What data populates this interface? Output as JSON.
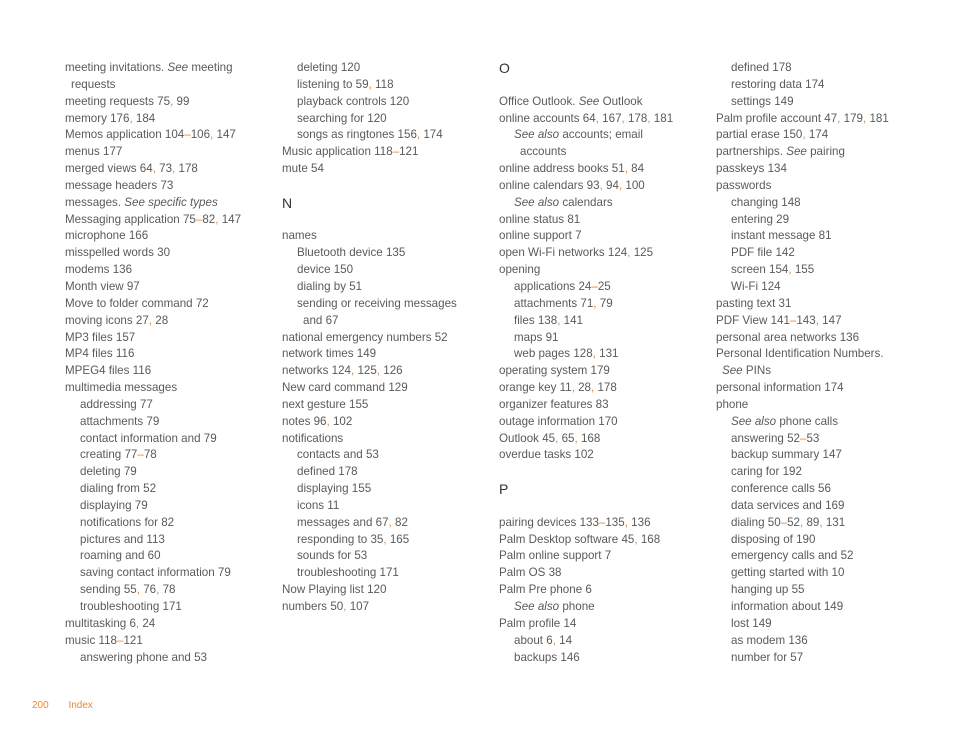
{
  "footer": {
    "page_number": "200",
    "section": "Index"
  },
  "columns": [
    [
      {
        "t": "entry",
        "lvl": 0,
        "text": "meeting invitations. ",
        "see": "See",
        "rest": " meeting"
      },
      {
        "t": "entry",
        "lvl": 0,
        "cont": true,
        "text": "requests"
      },
      {
        "t": "entry",
        "lvl": 0,
        "text": "meeting requests ",
        "pages": [
          "75",
          "99"
        ]
      },
      {
        "t": "entry",
        "lvl": 0,
        "text": "memory ",
        "pages": [
          "176",
          "184"
        ]
      },
      {
        "t": "entry",
        "lvl": 0,
        "text": "Memos application ",
        "pages": [
          "104–106",
          "147"
        ]
      },
      {
        "t": "entry",
        "lvl": 0,
        "text": "menus ",
        "pages": [
          "177"
        ]
      },
      {
        "t": "entry",
        "lvl": 0,
        "text": "merged views ",
        "pages": [
          "64",
          "73",
          "178"
        ]
      },
      {
        "t": "entry",
        "lvl": 0,
        "text": "message headers ",
        "pages": [
          "73"
        ]
      },
      {
        "t": "entry",
        "lvl": 0,
        "text": "messages. ",
        "italic": "See specific types"
      },
      {
        "t": "entry",
        "lvl": 0,
        "text": "Messaging application ",
        "pages": [
          "75–82",
          "147"
        ]
      },
      {
        "t": "entry",
        "lvl": 0,
        "text": "microphone ",
        "pages": [
          "166"
        ]
      },
      {
        "t": "entry",
        "lvl": 0,
        "text": "misspelled words ",
        "pages": [
          "30"
        ]
      },
      {
        "t": "entry",
        "lvl": 0,
        "text": "modems ",
        "pages": [
          "136"
        ]
      },
      {
        "t": "entry",
        "lvl": 0,
        "text": "Month view ",
        "pages": [
          "97"
        ]
      },
      {
        "t": "entry",
        "lvl": 0,
        "text": "Move to folder command ",
        "pages": [
          "72"
        ]
      },
      {
        "t": "entry",
        "lvl": 0,
        "text": "moving icons ",
        "pages": [
          "27",
          "28"
        ]
      },
      {
        "t": "entry",
        "lvl": 0,
        "text": "MP3 files ",
        "pages": [
          "157"
        ]
      },
      {
        "t": "entry",
        "lvl": 0,
        "text": "MP4 files ",
        "pages": [
          "116"
        ]
      },
      {
        "t": "entry",
        "lvl": 0,
        "text": "MPEG4 files ",
        "pages": [
          "116"
        ]
      },
      {
        "t": "entry",
        "lvl": 0,
        "text": "multimedia messages"
      },
      {
        "t": "entry",
        "lvl": 1,
        "text": "addressing ",
        "pages": [
          "77"
        ]
      },
      {
        "t": "entry",
        "lvl": 1,
        "text": "attachments ",
        "pages": [
          "79"
        ]
      },
      {
        "t": "entry",
        "lvl": 1,
        "text": "contact information and ",
        "pages": [
          "79"
        ]
      },
      {
        "t": "entry",
        "lvl": 1,
        "text": "creating ",
        "pages": [
          "77–78"
        ]
      },
      {
        "t": "entry",
        "lvl": 1,
        "text": "deleting ",
        "pages": [
          "79"
        ]
      },
      {
        "t": "entry",
        "lvl": 1,
        "text": "dialing from ",
        "pages": [
          "52"
        ]
      },
      {
        "t": "entry",
        "lvl": 1,
        "text": "displaying ",
        "pages": [
          "79"
        ]
      },
      {
        "t": "entry",
        "lvl": 1,
        "text": "notifications for ",
        "pages": [
          "82"
        ]
      },
      {
        "t": "entry",
        "lvl": 1,
        "text": "pictures and ",
        "pages": [
          "113"
        ]
      },
      {
        "t": "entry",
        "lvl": 1,
        "text": "roaming and ",
        "pages": [
          "60"
        ]
      },
      {
        "t": "entry",
        "lvl": 1,
        "text": "saving contact information ",
        "pages": [
          "79"
        ]
      },
      {
        "t": "entry",
        "lvl": 1,
        "text": "sending ",
        "pages": [
          "55",
          "76",
          "78"
        ]
      },
      {
        "t": "entry",
        "lvl": 1,
        "text": "troubleshooting ",
        "pages": [
          "171"
        ]
      },
      {
        "t": "entry",
        "lvl": 0,
        "text": "multitasking ",
        "pages": [
          "6",
          "24"
        ]
      },
      {
        "t": "entry",
        "lvl": 0,
        "text": "music ",
        "pages": [
          "118–121"
        ]
      },
      {
        "t": "entry",
        "lvl": 1,
        "text": "answering phone and ",
        "pages": [
          "53"
        ]
      }
    ],
    [
      {
        "t": "entry",
        "lvl": 1,
        "text": "deleting ",
        "pages": [
          "120"
        ]
      },
      {
        "t": "entry",
        "lvl": 1,
        "text": "listening to ",
        "pages": [
          "59",
          "118"
        ]
      },
      {
        "t": "entry",
        "lvl": 1,
        "text": "playback controls ",
        "pages": [
          "120"
        ]
      },
      {
        "t": "entry",
        "lvl": 1,
        "text": "searching for ",
        "pages": [
          "120"
        ]
      },
      {
        "t": "entry",
        "lvl": 1,
        "text": "songs as ringtones ",
        "pages": [
          "156",
          "174"
        ]
      },
      {
        "t": "entry",
        "lvl": 0,
        "text": "Music application ",
        "pages": [
          "118–121"
        ]
      },
      {
        "t": "entry",
        "lvl": 0,
        "text": "mute ",
        "pages": [
          "54"
        ]
      },
      {
        "t": "gap"
      },
      {
        "t": "letter",
        "text": "N"
      },
      {
        "t": "entry",
        "lvl": 0,
        "text": "names"
      },
      {
        "t": "entry",
        "lvl": 1,
        "text": "Bluetooth device ",
        "pages": [
          "135"
        ]
      },
      {
        "t": "entry",
        "lvl": 1,
        "text": "device ",
        "pages": [
          "150"
        ]
      },
      {
        "t": "entry",
        "lvl": 1,
        "text": "dialing by ",
        "pages": [
          "51"
        ]
      },
      {
        "t": "entry",
        "lvl": 1,
        "text": "sending or receiving messages"
      },
      {
        "t": "entry",
        "lvl": 1,
        "cont": true,
        "text": "and ",
        "pages": [
          "67"
        ]
      },
      {
        "t": "entry",
        "lvl": 0,
        "text": "national emergency numbers ",
        "pages": [
          "52"
        ]
      },
      {
        "t": "entry",
        "lvl": 0,
        "text": "network times ",
        "pages": [
          "149"
        ]
      },
      {
        "t": "entry",
        "lvl": 0,
        "text": "networks ",
        "pages": [
          "124",
          "125",
          "126"
        ]
      },
      {
        "t": "entry",
        "lvl": 0,
        "text": "New card command ",
        "pages": [
          "129"
        ]
      },
      {
        "t": "entry",
        "lvl": 0,
        "text": "next gesture ",
        "pages": [
          "155"
        ]
      },
      {
        "t": "entry",
        "lvl": 0,
        "text": "notes ",
        "pages": [
          "96",
          "102"
        ]
      },
      {
        "t": "entry",
        "lvl": 0,
        "text": "notifications"
      },
      {
        "t": "entry",
        "lvl": 1,
        "text": "contacts and ",
        "pages": [
          "53"
        ]
      },
      {
        "t": "entry",
        "lvl": 1,
        "text": "defined ",
        "pages": [
          "178"
        ]
      },
      {
        "t": "entry",
        "lvl": 1,
        "text": "displaying ",
        "pages": [
          "155"
        ]
      },
      {
        "t": "entry",
        "lvl": 1,
        "text": "icons ",
        "pages": [
          "11"
        ]
      },
      {
        "t": "entry",
        "lvl": 1,
        "text": "messages and ",
        "pages": [
          "67",
          "82"
        ]
      },
      {
        "t": "entry",
        "lvl": 1,
        "text": "responding to ",
        "pages": [
          "35",
          "165"
        ]
      },
      {
        "t": "entry",
        "lvl": 1,
        "text": "sounds for ",
        "pages": [
          "53"
        ]
      },
      {
        "t": "entry",
        "lvl": 1,
        "text": "troubleshooting ",
        "pages": [
          "171"
        ]
      },
      {
        "t": "entry",
        "lvl": 0,
        "text": "Now Playing list ",
        "pages": [
          "120"
        ]
      },
      {
        "t": "entry",
        "lvl": 0,
        "text": "numbers ",
        "pages": [
          "50",
          "107"
        ]
      }
    ],
    [
      {
        "t": "letter",
        "text": "O"
      },
      {
        "t": "entry",
        "lvl": 0,
        "text": "Office Outlook. ",
        "see": "See",
        "rest": " Outlook"
      },
      {
        "t": "entry",
        "lvl": 0,
        "text": "online accounts ",
        "pages": [
          "64",
          "167",
          "178",
          "181"
        ]
      },
      {
        "t": "entry",
        "lvl": 1,
        "see": "See also",
        "rest": " accounts; email"
      },
      {
        "t": "entry",
        "lvl": 1,
        "cont": true,
        "text": "accounts"
      },
      {
        "t": "entry",
        "lvl": 0,
        "text": "online address books ",
        "pages": [
          "51",
          "84"
        ]
      },
      {
        "t": "entry",
        "lvl": 0,
        "text": "online calendars ",
        "pages": [
          "93",
          "94",
          "100"
        ]
      },
      {
        "t": "entry",
        "lvl": 1,
        "see": "See also",
        "rest": " calendars"
      },
      {
        "t": "entry",
        "lvl": 0,
        "text": "online status ",
        "pages": [
          "81"
        ]
      },
      {
        "t": "entry",
        "lvl": 0,
        "text": "online support ",
        "pages": [
          "7"
        ]
      },
      {
        "t": "entry",
        "lvl": 0,
        "text": "open Wi-Fi networks ",
        "pages": [
          "124",
          "125"
        ]
      },
      {
        "t": "entry",
        "lvl": 0,
        "text": "opening"
      },
      {
        "t": "entry",
        "lvl": 1,
        "text": "applications ",
        "pages": [
          "24–25"
        ]
      },
      {
        "t": "entry",
        "lvl": 1,
        "text": "attachments ",
        "pages": [
          "71",
          "79"
        ]
      },
      {
        "t": "entry",
        "lvl": 1,
        "text": "files ",
        "pages": [
          "138",
          "141"
        ]
      },
      {
        "t": "entry",
        "lvl": 1,
        "text": "maps ",
        "pages": [
          "91"
        ]
      },
      {
        "t": "entry",
        "lvl": 1,
        "text": "web pages ",
        "pages": [
          "128",
          "131"
        ]
      },
      {
        "t": "entry",
        "lvl": 0,
        "text": "operating system ",
        "pages": [
          "179"
        ]
      },
      {
        "t": "entry",
        "lvl": 0,
        "text": "orange key ",
        "pages": [
          "11",
          "28",
          "178"
        ]
      },
      {
        "t": "entry",
        "lvl": 0,
        "text": "organizer features ",
        "pages": [
          "83"
        ]
      },
      {
        "t": "entry",
        "lvl": 0,
        "text": "outage information ",
        "pages": [
          "170"
        ]
      },
      {
        "t": "entry",
        "lvl": 0,
        "text": "Outlook ",
        "pages": [
          "45",
          "65",
          "168"
        ]
      },
      {
        "t": "entry",
        "lvl": 0,
        "text": "overdue tasks ",
        "pages": [
          "102"
        ]
      },
      {
        "t": "gap"
      },
      {
        "t": "letter",
        "text": "P"
      },
      {
        "t": "entry",
        "lvl": 0,
        "text": "pairing devices ",
        "pages": [
          "133–135",
          "136"
        ]
      },
      {
        "t": "entry",
        "lvl": 0,
        "text": "Palm Desktop software ",
        "pages": [
          "45",
          "168"
        ]
      },
      {
        "t": "entry",
        "lvl": 0,
        "text": "Palm online support ",
        "pages": [
          "7"
        ]
      },
      {
        "t": "entry",
        "lvl": 0,
        "text": "Palm OS ",
        "pages": [
          "38"
        ]
      },
      {
        "t": "entry",
        "lvl": 0,
        "text": "Palm Pre phone ",
        "pages": [
          "6"
        ]
      },
      {
        "t": "entry",
        "lvl": 1,
        "see": "See also",
        "rest": " phone"
      },
      {
        "t": "entry",
        "lvl": 0,
        "text": "Palm profile ",
        "pages": [
          "14"
        ]
      },
      {
        "t": "entry",
        "lvl": 1,
        "text": "about ",
        "pages": [
          "6",
          "14"
        ]
      },
      {
        "t": "entry",
        "lvl": 1,
        "text": "backups ",
        "pages": [
          "146"
        ]
      }
    ],
    [
      {
        "t": "entry",
        "lvl": 1,
        "text": "defined ",
        "pages": [
          "178"
        ]
      },
      {
        "t": "entry",
        "lvl": 1,
        "text": "restoring data ",
        "pages": [
          "174"
        ]
      },
      {
        "t": "entry",
        "lvl": 1,
        "text": "settings ",
        "pages": [
          "149"
        ]
      },
      {
        "t": "entry",
        "lvl": 0,
        "text": "Palm profile account ",
        "pages": [
          "47",
          "179",
          "181"
        ]
      },
      {
        "t": "entry",
        "lvl": 0,
        "text": "partial erase ",
        "pages": [
          "150",
          "174"
        ]
      },
      {
        "t": "entry",
        "lvl": 0,
        "text": "partnerships. ",
        "see": "See",
        "rest": " pairing"
      },
      {
        "t": "entry",
        "lvl": 0,
        "text": "passkeys ",
        "pages": [
          "134"
        ]
      },
      {
        "t": "entry",
        "lvl": 0,
        "text": "passwords"
      },
      {
        "t": "entry",
        "lvl": 1,
        "text": "changing ",
        "pages": [
          "148"
        ]
      },
      {
        "t": "entry",
        "lvl": 1,
        "text": "entering ",
        "pages": [
          "29"
        ]
      },
      {
        "t": "entry",
        "lvl": 1,
        "text": "instant message ",
        "pages": [
          "81"
        ]
      },
      {
        "t": "entry",
        "lvl": 1,
        "text": "PDF file ",
        "pages": [
          "142"
        ]
      },
      {
        "t": "entry",
        "lvl": 1,
        "text": "screen ",
        "pages": [
          "154",
          "155"
        ]
      },
      {
        "t": "entry",
        "lvl": 1,
        "text": "Wi-Fi ",
        "pages": [
          "124"
        ]
      },
      {
        "t": "entry",
        "lvl": 0,
        "text": "pasting text ",
        "pages": [
          "31"
        ]
      },
      {
        "t": "entry",
        "lvl": 0,
        "text": "PDF View ",
        "pages": [
          "141–143",
          "147"
        ]
      },
      {
        "t": "entry",
        "lvl": 0,
        "text": "personal area networks ",
        "pages": [
          "136"
        ]
      },
      {
        "t": "entry",
        "lvl": 0,
        "text": "Personal Identification Numbers."
      },
      {
        "t": "entry",
        "lvl": 0,
        "cont": true,
        "see": "See",
        "rest": " PINs"
      },
      {
        "t": "entry",
        "lvl": 0,
        "text": "personal information ",
        "pages": [
          "174"
        ]
      },
      {
        "t": "entry",
        "lvl": 0,
        "text": "phone"
      },
      {
        "t": "entry",
        "lvl": 1,
        "see": "See also",
        "rest": " phone calls"
      },
      {
        "t": "entry",
        "lvl": 1,
        "text": "answering ",
        "pages": [
          "52–53"
        ]
      },
      {
        "t": "entry",
        "lvl": 1,
        "text": "backup summary ",
        "pages": [
          "147"
        ]
      },
      {
        "t": "entry",
        "lvl": 1,
        "text": "caring for ",
        "pages": [
          "192"
        ]
      },
      {
        "t": "entry",
        "lvl": 1,
        "text": "conference calls ",
        "pages": [
          "56"
        ]
      },
      {
        "t": "entry",
        "lvl": 1,
        "text": "data services and ",
        "pages": [
          "169"
        ]
      },
      {
        "t": "entry",
        "lvl": 1,
        "text": "dialing ",
        "pages": [
          "50–52",
          "89",
          "131"
        ]
      },
      {
        "t": "entry",
        "lvl": 1,
        "text": "disposing of ",
        "pages": [
          "190"
        ]
      },
      {
        "t": "entry",
        "lvl": 1,
        "text": "emergency calls and ",
        "pages": [
          "52"
        ]
      },
      {
        "t": "entry",
        "lvl": 1,
        "text": "getting started with ",
        "pages": [
          "10"
        ]
      },
      {
        "t": "entry",
        "lvl": 1,
        "text": "hanging up ",
        "pages": [
          "55"
        ]
      },
      {
        "t": "entry",
        "lvl": 1,
        "text": "information about ",
        "pages": [
          "149"
        ]
      },
      {
        "t": "entry",
        "lvl": 1,
        "text": "lost ",
        "pages": [
          "149"
        ]
      },
      {
        "t": "entry",
        "lvl": 1,
        "text": "as modem ",
        "pages": [
          "136"
        ]
      },
      {
        "t": "entry",
        "lvl": 1,
        "text": "number for ",
        "pages": [
          "57"
        ]
      }
    ]
  ]
}
